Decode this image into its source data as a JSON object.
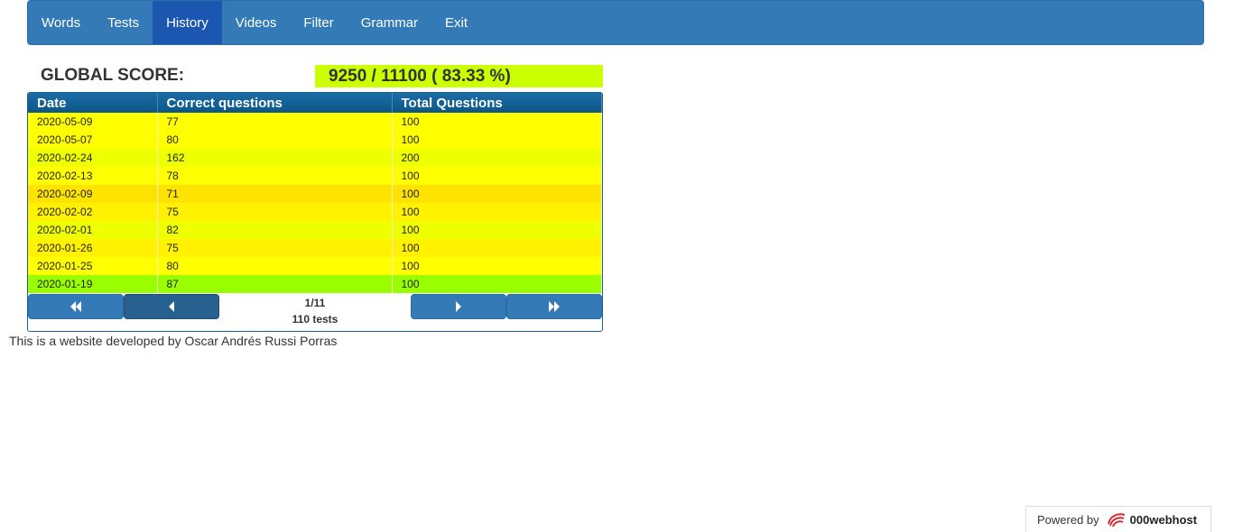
{
  "nav": {
    "items": [
      {
        "label": "Words",
        "active": false
      },
      {
        "label": "Tests",
        "active": false
      },
      {
        "label": "History",
        "active": true
      },
      {
        "label": "Videos",
        "active": false
      },
      {
        "label": "Filter",
        "active": false
      },
      {
        "label": "Grammar",
        "active": false
      },
      {
        "label": "Exit",
        "active": false
      }
    ]
  },
  "score": {
    "label": "GLOBAL SCORE:",
    "value": "9250 / 11100 ( 83.33 %)"
  },
  "table": {
    "headers": [
      "Date",
      "Correct questions",
      "Total Questions"
    ],
    "rows": [
      {
        "date": "2020-05-09",
        "correct": "77",
        "total": "100",
        "color": "#ffff00"
      },
      {
        "date": "2020-05-07",
        "correct": "80",
        "total": "100",
        "color": "#ffff00"
      },
      {
        "date": "2020-02-24",
        "correct": "162",
        "total": "200",
        "color": "#eeff00"
      },
      {
        "date": "2020-02-13",
        "correct": "78",
        "total": "100",
        "color": "#ffff00"
      },
      {
        "date": "2020-02-09",
        "correct": "71",
        "total": "100",
        "color": "#ffe300"
      },
      {
        "date": "2020-02-02",
        "correct": "75",
        "total": "100",
        "color": "#fff100"
      },
      {
        "date": "2020-02-01",
        "correct": "82",
        "total": "100",
        "color": "#eeff00"
      },
      {
        "date": "2020-01-26",
        "correct": "75",
        "total": "100",
        "color": "#fff100"
      },
      {
        "date": "2020-01-25",
        "correct": "80",
        "total": "100",
        "color": "#ffff00"
      },
      {
        "date": "2020-01-19",
        "correct": "87",
        "total": "100",
        "color": "#99ff00"
      }
    ]
  },
  "pager": {
    "page": "1/11",
    "count": "110 tests",
    "first_icon": "double-chevron-left-icon",
    "prev_icon": "chevron-left-icon",
    "next_icon": "chevron-right-icon",
    "last_icon": "double-chevron-right-icon"
  },
  "footer": {
    "text": "This is a website developed by Oscar Andrés Russi Porras"
  },
  "powered": {
    "prefix": "Powered by",
    "brand": "000webhost"
  }
}
